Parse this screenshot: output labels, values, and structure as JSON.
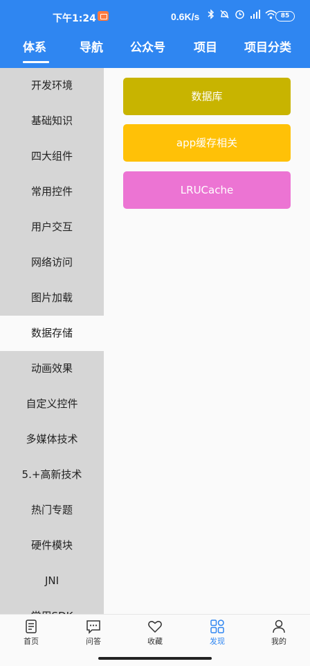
{
  "status_bar": {
    "time": "下午1:24",
    "net_speed": "0.6K/s",
    "battery": "85",
    "icons": [
      "bluetooth-icon",
      "dnd-icon",
      "alarm-icon",
      "hd-signal-icon",
      "wifi-icon",
      "battery-icon"
    ]
  },
  "tabs": [
    {
      "label": "体系",
      "active": true
    },
    {
      "label": "导航"
    },
    {
      "label": "公众号"
    },
    {
      "label": "项目"
    },
    {
      "label": "项目分类"
    }
  ],
  "categories": [
    "开发环境",
    "基础知识",
    "四大组件",
    "常用控件",
    "用户交互",
    "网络访问",
    "图片加载",
    "数据存储",
    "动画效果",
    "自定义控件",
    "多媒体技术",
    "5.+高新技术",
    "热门专题",
    "硬件模块",
    "JNI",
    "常用SDK"
  ],
  "active_category": "数据存储",
  "sub_items": [
    {
      "label": "数据库",
      "color": "#c8b400"
    },
    {
      "label": "app缓存相关",
      "color": "#ffc107"
    },
    {
      "label": "LRUCache",
      "color": "#ec74d3"
    }
  ],
  "bottom_nav": [
    {
      "label": "首页",
      "icon": "home-page-icon"
    },
    {
      "label": "问答",
      "icon": "chat-icon"
    },
    {
      "label": "收藏",
      "icon": "heart-icon"
    },
    {
      "label": "发现",
      "icon": "grid-icon",
      "active": true
    },
    {
      "label": "我的",
      "icon": "person-icon"
    }
  ],
  "colors": {
    "primary": "#2f86f1",
    "sidebar_bg": "#d6d6d6",
    "page_bg": "#fafafa"
  }
}
